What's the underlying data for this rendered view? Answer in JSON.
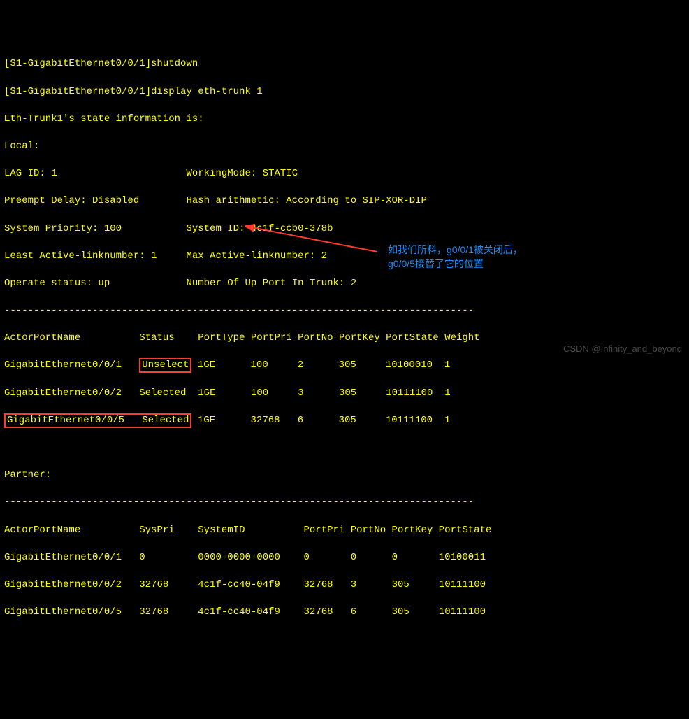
{
  "cmd": {
    "shutdown": "[S1-GigabitEthernet0/0/1]shutdown",
    "display": "[S1-GigabitEthernet0/0/1]display eth-trunk 1"
  },
  "state_title": "Eth-Trunk1's state information is:",
  "local_label": "Local:",
  "info": {
    "lag_id_label": "LAG ID: 1",
    "workingmode": "WorkingMode: STATIC",
    "preempt": "Preempt Delay: Disabled",
    "hash": "Hash arithmetic: According to SIP-XOR-DIP",
    "sys_pri": "System Priority: 100",
    "sys_id": "System ID: 4c1f-ccb0-378b",
    "least": "Least Active-linknumber: 1",
    "max": "Max Active-linknumber: 2",
    "operate": "Operate status: up",
    "upports": "Number Of Up Port In Trunk: 2"
  },
  "sep": "--------------------------------------------------------------------------------",
  "actor_header": {
    "name": "ActorPortName",
    "status": "Status",
    "ptype": "PortType",
    "ppri": "PortPri",
    "pno": "PortNo",
    "pkey": "PortKey",
    "pstate": "PortState",
    "weight": "Weight"
  },
  "actor_rows": [
    {
      "name": "GigabitEthernet0/0/1",
      "status": "Unselect",
      "ptype": "1GE",
      "ppri": "100",
      "pno": "2",
      "pkey": "305",
      "pstate": "10100010",
      "weight": "1"
    },
    {
      "name": "GigabitEthernet0/0/2",
      "status": "Selected",
      "ptype": "1GE",
      "ppri": "100",
      "pno": "3",
      "pkey": "305",
      "pstate": "10111100",
      "weight": "1"
    },
    {
      "name": "GigabitEthernet0/0/5",
      "status": "Selected",
      "ptype": "1GE",
      "ppri": "32768",
      "pno": "6",
      "pkey": "305",
      "pstate": "10111100",
      "weight": "1"
    }
  ],
  "partner_label": "Partner:",
  "partner_header": {
    "name": "ActorPortName",
    "syspri": "SysPri",
    "sysid": "SystemID",
    "ppri": "PortPri",
    "pno": "PortNo",
    "pkey": "PortKey",
    "pstate": "PortState"
  },
  "partner_rows": [
    {
      "name": "GigabitEthernet0/0/1",
      "syspri": "0",
      "sysid": "0000-0000-0000",
      "ppri": "0",
      "pno": "0",
      "pkey": "0",
      "pstate": "10100011"
    },
    {
      "name": "GigabitEthernet0/0/2",
      "syspri": "32768",
      "sysid": "4c1f-cc40-04f9",
      "ppri": "32768",
      "pno": "3",
      "pkey": "305",
      "pstate": "10111100"
    },
    {
      "name": "GigabitEthernet0/0/5",
      "syspri": "32768",
      "sysid": "4c1f-cc40-04f9",
      "ppri": "32768",
      "pno": "6",
      "pkey": "305",
      "pstate": "10111100"
    }
  ],
  "annotation": {
    "line1": "如我们所料，g0/0/1被关闭后，",
    "line2": "g0/0/5接替了它的位置"
  },
  "watermark": "CSDN @Infinity_and_beyond"
}
